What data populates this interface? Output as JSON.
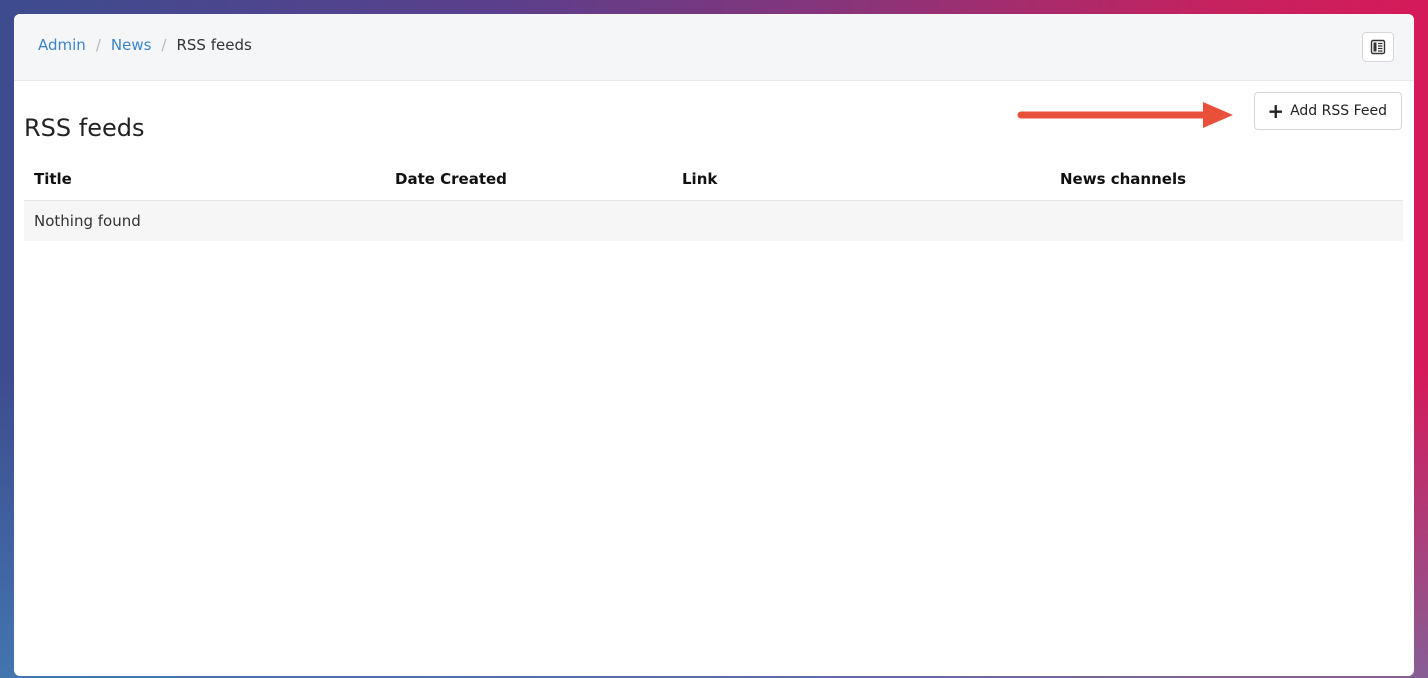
{
  "breadcrumb": {
    "items": [
      "Admin",
      "News"
    ],
    "separator": "/",
    "current": "RSS feeds"
  },
  "toolbar": {
    "toggle_icon": "newspaper-icon",
    "add_button": {
      "icon": "plus-icon",
      "label": "Add RSS Feed"
    }
  },
  "page": {
    "title": "RSS feeds"
  },
  "table": {
    "columns": [
      "Title",
      "Date Created",
      "Link",
      "News channels"
    ],
    "empty_text": "Nothing found"
  },
  "annotation": {
    "type": "arrow",
    "color": "#e8503a",
    "points_to": "add-rss-feed-button"
  },
  "colors": {
    "link": "#3a85c9",
    "topbar_bg": "#f5f6f8",
    "row_bg": "#f6f6f7"
  }
}
